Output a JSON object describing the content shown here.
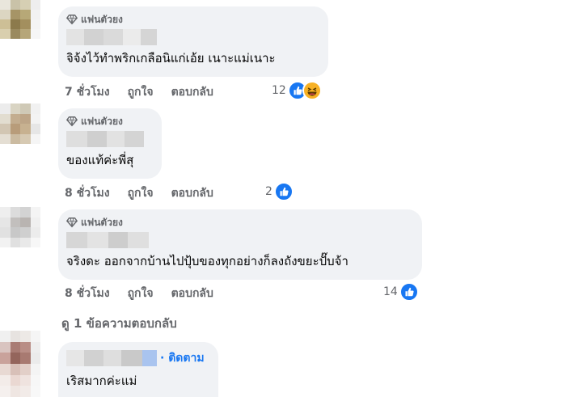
{
  "comments": [
    {
      "badge": "แฟนตัวยง",
      "text": "จิจ้งไว้ทำพริกเกลือนิแก่เอ้ย เนาะแม่เนาะ",
      "time": "7 ชั่วโมง",
      "like": "ถูกใจ",
      "reply": "ตอบกลับ",
      "reaction_count": "12",
      "reactions": [
        "like-icon",
        "haha-icon"
      ]
    },
    {
      "badge": "แฟนตัวยง",
      "text": "ของแท้ค่ะพี่สุ",
      "time": "8 ชั่วโมง",
      "like": "ถูกใจ",
      "reply": "ตอบกลับ",
      "reaction_count": "2",
      "reactions": [
        "like-icon"
      ]
    },
    {
      "badge": "แฟนตัวยง",
      "text": "จริงดะ ออกจากบ้านไปปุ้บของทุกอย่างก็ลงถังขยะปั๊บจ้า",
      "time": "8 ชั่วโมง",
      "like": "ถูกใจ",
      "reply": "ตอบกลับ",
      "reaction_count": "14",
      "reactions": [
        "like-icon"
      ]
    },
    {
      "follow": "· ติดตาม",
      "text": "เริสมากค่ะแม่"
    }
  ],
  "view_replies": "ดู 1 ข้อความตอบกลับ",
  "colors": {
    "like": "#1877f2",
    "bubble": "#f0f2f5",
    "meta": "#65676b",
    "haha": "#f7b125"
  }
}
